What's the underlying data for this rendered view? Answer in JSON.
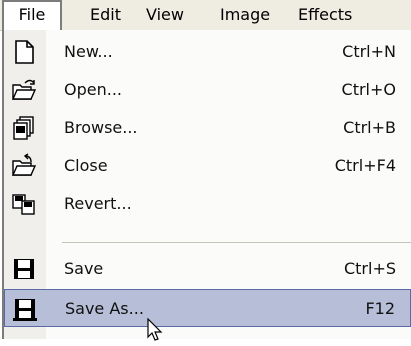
{
  "menubar": {
    "items": [
      {
        "label": "File"
      },
      {
        "label": "Edit"
      },
      {
        "label": "View"
      },
      {
        "label": "Image"
      },
      {
        "label": "Effects"
      }
    ]
  },
  "file_menu": {
    "items": [
      {
        "label": "New...",
        "shortcut": "Ctrl+N",
        "icon": "new-file-icon"
      },
      {
        "label": "Open...",
        "shortcut": "Ctrl+O",
        "icon": "open-folder-icon"
      },
      {
        "label": "Browse...",
        "shortcut": "Ctrl+B",
        "icon": "browse-icon"
      },
      {
        "label": "Close",
        "shortcut": "Ctrl+F4",
        "icon": "close-folder-icon"
      },
      {
        "label": "Revert...",
        "shortcut": "",
        "icon": "revert-icon"
      },
      {
        "label": "Save",
        "shortcut": "Ctrl+S",
        "icon": "save-disk-icon"
      },
      {
        "label": "Save As...",
        "shortcut": "F12",
        "icon": "save-as-disk-icon",
        "highlighted": true
      }
    ]
  },
  "colors": {
    "menubar_bg": "#efece2",
    "highlight_bg": "#b7bfd8",
    "highlight_border": "#5a6aa6",
    "icon_column_bg": "#f0efeb"
  }
}
